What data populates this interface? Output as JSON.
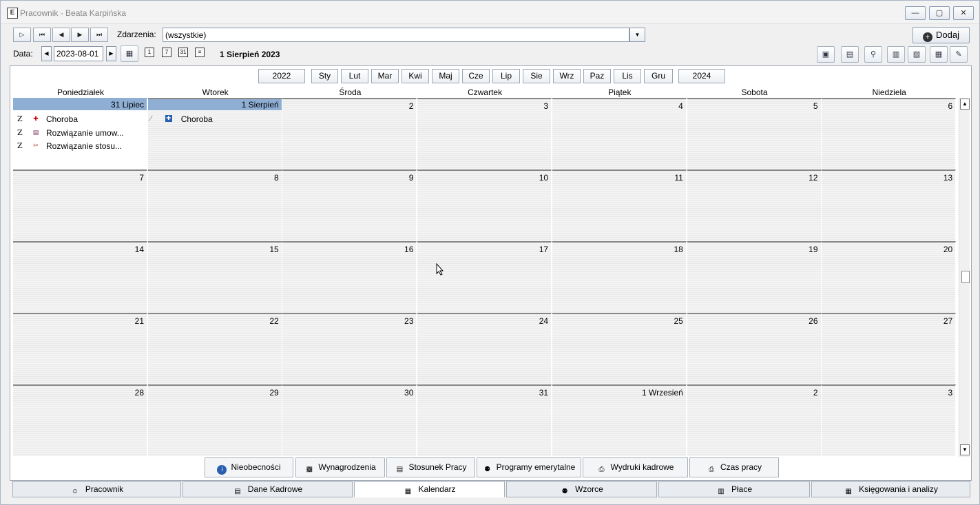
{
  "window": {
    "title": "Pracownik - Beata Karpińska"
  },
  "toolbar": {
    "events_label": "Zdarzenia:",
    "events_value": "(wszystkie)",
    "add_label": "Dodaj",
    "date_label": "Data:",
    "date_value": "2023-08-01",
    "current_date": "1 Sierpień 2023"
  },
  "calendar": {
    "prev_year": "2022",
    "next_year": "2024",
    "months": [
      "Sty",
      "Lut",
      "Mar",
      "Kwi",
      "Maj",
      "Cze",
      "Lip",
      "Sie",
      "Wrz",
      "Paz",
      "Lis",
      "Gru"
    ],
    "weekdays": [
      "Poniedziałek",
      "Wtorek",
      "Środa",
      "Czwartek",
      "Piątek",
      "Sobota",
      "Niedziela"
    ],
    "weeks": [
      [
        "31 Lipiec",
        "1 Sierpień",
        "2",
        "3",
        "4",
        "5",
        "6"
      ],
      [
        "7",
        "8",
        "9",
        "10",
        "11",
        "12",
        "13"
      ],
      [
        "14",
        "15",
        "16",
        "17",
        "18",
        "19",
        "20"
      ],
      [
        "21",
        "22",
        "23",
        "24",
        "25",
        "26",
        "27"
      ],
      [
        "28",
        "29",
        "30",
        "31",
        "1 Wrzesień",
        "2",
        "3"
      ]
    ],
    "events": {
      "mon": [
        {
          "mark": "Z",
          "label": "Choroba"
        },
        {
          "mark": "Z",
          "label": "Rozwiązanie umow..."
        },
        {
          "mark": "Z",
          "label": "Rozwiązanie stosu..."
        }
      ],
      "tue": [
        {
          "mark": "⁄",
          "label": "Choroba"
        }
      ]
    }
  },
  "subtabs": [
    "Nieobecności",
    "Wynagrodzenia",
    "Stosunek Pracy",
    "Programy emerytalne",
    "Wydruki kadrowe",
    "Czas pracy"
  ],
  "maintabs": [
    "Pracownik",
    "Dane Kadrowe",
    "Kalendarz",
    "Wzorce",
    "Płace",
    "Księgowania i analizy"
  ],
  "colors": {
    "selected_day_bar": "#8eaed4",
    "frame": "#a9b6c6"
  }
}
